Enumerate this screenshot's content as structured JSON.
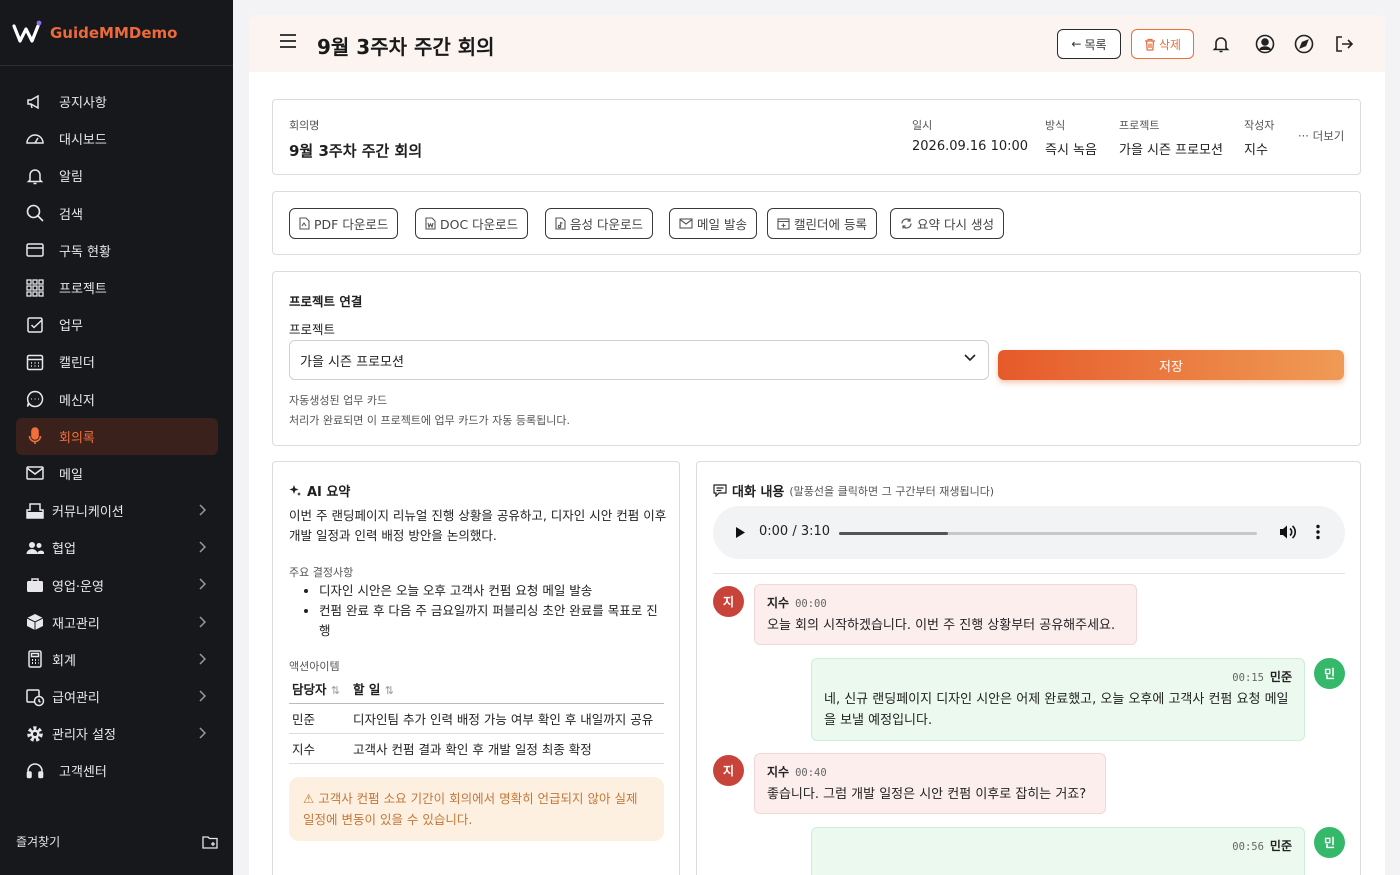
{
  "brand": {
    "name": "GuideMMDemo",
    "accent": "#ee6a3a"
  },
  "sidebar": {
    "items": [
      {
        "label": "공지사항",
        "icon": "megaphone-icon"
      },
      {
        "label": "대시보드",
        "icon": "gauge-icon"
      },
      {
        "label": "알림",
        "icon": "bell-icon"
      },
      {
        "label": "검색",
        "icon": "search-icon"
      },
      {
        "label": "구독 현황",
        "icon": "credit-card-icon"
      },
      {
        "label": "프로젝트",
        "icon": "grid-icon"
      },
      {
        "label": "업무",
        "icon": "checkbox-icon"
      },
      {
        "label": "캘린더",
        "icon": "calendar-icon"
      },
      {
        "label": "메신저",
        "icon": "chat-icon"
      },
      {
        "label": "회의록",
        "icon": "microphone-icon",
        "active": true
      },
      {
        "label": "메일",
        "icon": "mail-icon"
      },
      {
        "label": "커뮤니케이션",
        "icon": "inbox-icon",
        "group": true
      },
      {
        "label": "협업",
        "icon": "users-icon",
        "group": true
      },
      {
        "label": "영업·운영",
        "icon": "briefcase-icon",
        "group": true
      },
      {
        "label": "재고관리",
        "icon": "box-icon",
        "group": true
      },
      {
        "label": "회계",
        "icon": "calculator-icon",
        "group": true
      },
      {
        "label": "급여관리",
        "icon": "payroll-icon",
        "group": true
      },
      {
        "label": "관리자 설정",
        "icon": "gear-icon",
        "group": true
      },
      {
        "label": "고객센터",
        "icon": "headset-icon"
      }
    ],
    "favorites_label": "즐겨찾기"
  },
  "header": {
    "title": "9월 3주차 주간 회의",
    "back_label": "목록",
    "delete_label": "삭제"
  },
  "meeting": {
    "name_label": "회의명",
    "name": "9월 3주차 주간 회의",
    "date_label": "일시",
    "date": "2026.09.16 10:00",
    "method_label": "방식",
    "method": "즉시 녹음",
    "project_label": "프로젝트",
    "project": "가을 시즌 프로모션",
    "author_label": "작성자",
    "author": "지수",
    "more_label": "더보기"
  },
  "actions": {
    "pdf": "PDF 다운로드",
    "doc": "DOC 다운로드",
    "audio": "음성 다운로드",
    "mail": "메일 발송",
    "calendar": "캘린더에 등록",
    "regen": "요약 다시 생성"
  },
  "project_link": {
    "title": "프로젝트 연결",
    "field_label": "프로젝트",
    "selected": "가을 시즌 프로모션",
    "save_label": "저장",
    "auto_title": "자동생성된 업무 카드",
    "auto_desc": "처리가 완료되면 이 프로젝트에 업무 카드가 자동 등록됩니다."
  },
  "summary": {
    "title": "AI 요약",
    "text": "이번 주 랜딩페이지 리뉴얼 진행 상황을 공유하고, 디자인 시안 컨펌 이후 개발 일정과 인력 배정 방안을 논의했다.",
    "decisions_label": "주요 결정사항",
    "decisions": [
      "디자인 시안은 오늘 오후 고객사 컨펌 요청 메일 발송",
      "컨펌 완료 후 다음 주 금요일까지 퍼블리싱 초안 완료를 목표로 진행"
    ],
    "action_label": "액션아이템",
    "col_owner": "담당자",
    "col_task": "할 일",
    "rows": [
      {
        "owner": "민준",
        "task": "디자인팀 추가 인력 배정 가능 여부 확인 후 내일까지 공유"
      },
      {
        "owner": "지수",
        "task": "고객사 컨펌 결과 확인 후 개발 일정 최종 확정"
      }
    ],
    "warning": "고객사 컨펌 소요 기간이 회의에서 명확히 언급되지 않아 실제 일정에 변동이 있을 수 있습니다."
  },
  "transcript": {
    "title": "대화 내용",
    "hint": "(말풍선을 클릭하면 그 구간부터 재생됩니다)",
    "player": {
      "time": "0:00 / 3:10",
      "progress": 0.26
    },
    "messages": [
      {
        "speaker": "지수",
        "initial": "지",
        "time": "00:00",
        "side": "left",
        "text": "오늘 회의 시작하겠습니다. 이번 주 진행 상황부터 공유해주세요."
      },
      {
        "speaker": "민준",
        "initial": "민",
        "time": "00:15",
        "side": "right",
        "text": "네, 신규 랜딩페이지 디자인 시안은 어제 완료했고, 오늘 오후에 고객사 컨펌 요청 메일을 보낼 예정입니다."
      },
      {
        "speaker": "지수",
        "initial": "지",
        "time": "00:40",
        "side": "left",
        "text": "좋습니다. 그럼 개발 일정은 시안 컨펌 이후로 잡히는 거죠?"
      },
      {
        "speaker": "민준",
        "initial": "민",
        "time": "00:56",
        "side": "right",
        "text": ""
      }
    ]
  }
}
